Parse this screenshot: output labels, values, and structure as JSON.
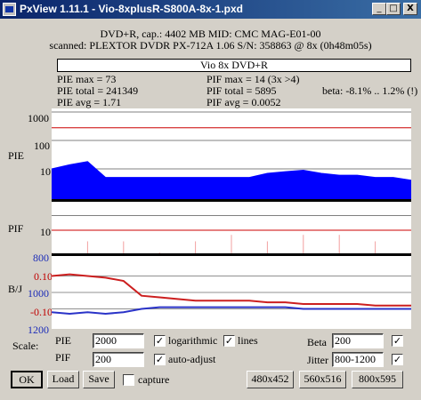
{
  "window": {
    "title": "PxView 1.11.1  -  Vio-8xplusR-S800A-8x-1.pxd",
    "minimize_label": "_",
    "maximize_label": "□",
    "close_label": "X"
  },
  "header": {
    "line1": "DVD+R, cap.: 4402 MB MID: CMC MAG-E01-00",
    "line2": "scanned: PLEXTOR DVDR PX-712A 1.06 S/N: 358863 @ 8x (0h48m05s)",
    "disc_label": "Vio 8x DVD+R"
  },
  "stats": {
    "pie_max": "PIE max = 73",
    "pie_total": "PIE total = 241349",
    "pie_avg": "PIE avg = 1.71",
    "pif_max": "PIF max = 14 (3x >4)",
    "pif_total": "PIF total = 5895",
    "pif_avg": "PIF avg = 0.0052",
    "beta": "beta: -8.1% .. 1.2% (!)"
  },
  "axes": {
    "pie_label": "PIE",
    "pif_label": "PIF",
    "bj_label": "B/J",
    "pie_ticks": [
      "1000",
      "100",
      "10"
    ],
    "pif_ticks": [
      "10"
    ],
    "jitter_ticks": [
      "800",
      "1000",
      "1200"
    ],
    "beta_ticks": [
      "0.10",
      "-0.10"
    ]
  },
  "chart_data": [
    {
      "type": "area",
      "name": "PIE",
      "scale": "log",
      "ylim": [
        1,
        1000
      ],
      "threshold": 280,
      "x": [
        0,
        5,
        10,
        15,
        20,
        25,
        30,
        35,
        40,
        45,
        50,
        55,
        60,
        65,
        70,
        75,
        80,
        85,
        90,
        95,
        100
      ],
      "values": [
        10,
        14,
        18,
        5,
        5,
        5,
        5,
        5,
        5,
        5,
        5,
        5,
        7,
        8,
        9,
        7,
        6,
        6,
        5,
        5,
        4
      ]
    },
    {
      "type": "area",
      "name": "PIF",
      "scale": "log",
      "ylim": [
        1,
        20
      ],
      "threshold": 4,
      "x": [
        0,
        10,
        20,
        30,
        40,
        50,
        60,
        70,
        80,
        90,
        100
      ],
      "values": [
        1,
        2,
        2,
        1,
        2,
        3,
        2,
        3,
        3,
        2,
        1
      ]
    },
    {
      "type": "line",
      "name": "Beta / Jitter",
      "x": [
        0,
        5,
        10,
        15,
        20,
        25,
        30,
        35,
        40,
        45,
        50,
        55,
        60,
        65,
        70,
        75,
        80,
        85,
        90,
        95,
        100
      ],
      "series": [
        {
          "values": [
            0.1,
            0.11,
            0.1,
            0.09,
            0.07,
            -0.02,
            -0.03,
            -0.04,
            -0.05,
            -0.05,
            -0.05,
            -0.05,
            -0.06,
            -0.06,
            -0.07,
            -0.07,
            -0.07,
            -0.07,
            -0.08,
            -0.08,
            -0.08
          ],
          "color": "#cc1f1f"
        },
        {
          "values": [
            -0.12,
            -0.13,
            -0.12,
            -0.13,
            -0.12,
            -0.1,
            -0.09,
            -0.09,
            -0.09,
            -0.09,
            -0.09,
            -0.09,
            -0.09,
            -0.09,
            -0.1,
            -0.1,
            -0.1,
            -0.1,
            -0.1,
            -0.1,
            -0.1
          ],
          "color": "#2a33c8"
        }
      ]
    }
  ],
  "controls": {
    "scale_label": "Scale:",
    "pie_label": "PIE",
    "pie_value": "2000",
    "pif_label": "PIF",
    "pif_value": "200",
    "logarithmic_label": "logarithmic",
    "logarithmic_checked": "✓",
    "lines_label": "lines",
    "lines_checked": "✓",
    "auto_adjust_label": "auto-adjust",
    "auto_adjust_checked": "✓",
    "beta_label": "Beta",
    "beta_value": "200",
    "beta_checked": "✓",
    "jitter_label": "Jitter",
    "jitter_value": "800-1200",
    "jitter_checked": "✓",
    "capture_label": "capture",
    "capture_checked": ""
  },
  "buttons": {
    "ok": "OK",
    "load": "Load",
    "save": "Save",
    "size1": "480x452",
    "size2": "560x516",
    "size3": "800x595"
  },
  "colors": {
    "pie_fill": "#0000ff",
    "threshold": "#cc0000",
    "jitter_axis": "#1c2cb8",
    "beta_axis": "#c00000"
  }
}
